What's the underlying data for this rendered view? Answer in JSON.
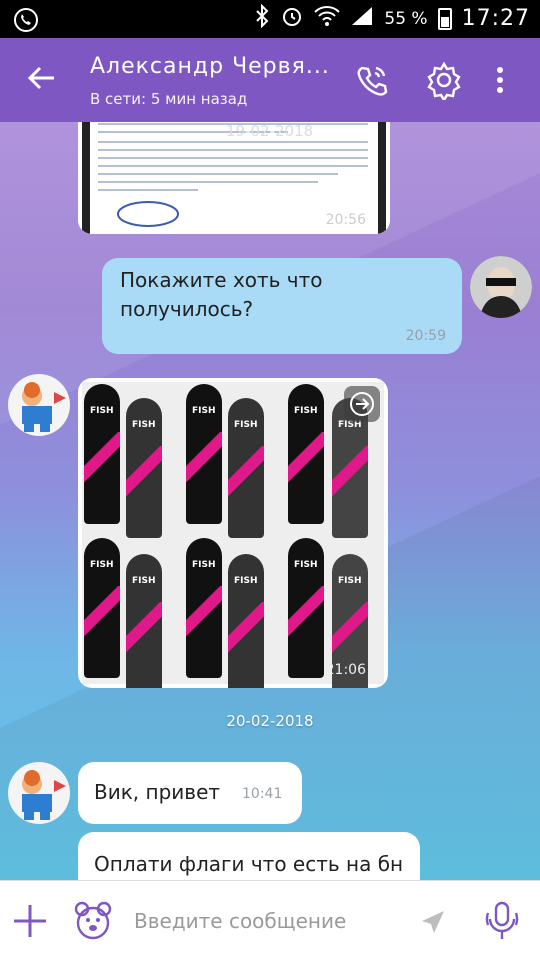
{
  "status_bar": {
    "battery": "55 %",
    "time": "17:27"
  },
  "header": {
    "title": "Александр Червя...",
    "subtitle": "В сети: 5 мин назад"
  },
  "messages": {
    "doc_date": "19-02-2018",
    "doc_time": "20:56",
    "out_text": "Покажите хоть что получилось?",
    "out_time": "20:59",
    "flags_time": "21:06",
    "date_sep": "20-02-2018",
    "in1_text": "Вик, привет",
    "in1_time": "10:41",
    "in2_text": "Оплати флаги что есть на бн"
  },
  "composer": {
    "placeholder": "Введите сообщение"
  },
  "colors": {
    "header": "#7e57c2",
    "accent": "#7e57c2",
    "outgoing_bubble": "#a9dbf6"
  }
}
